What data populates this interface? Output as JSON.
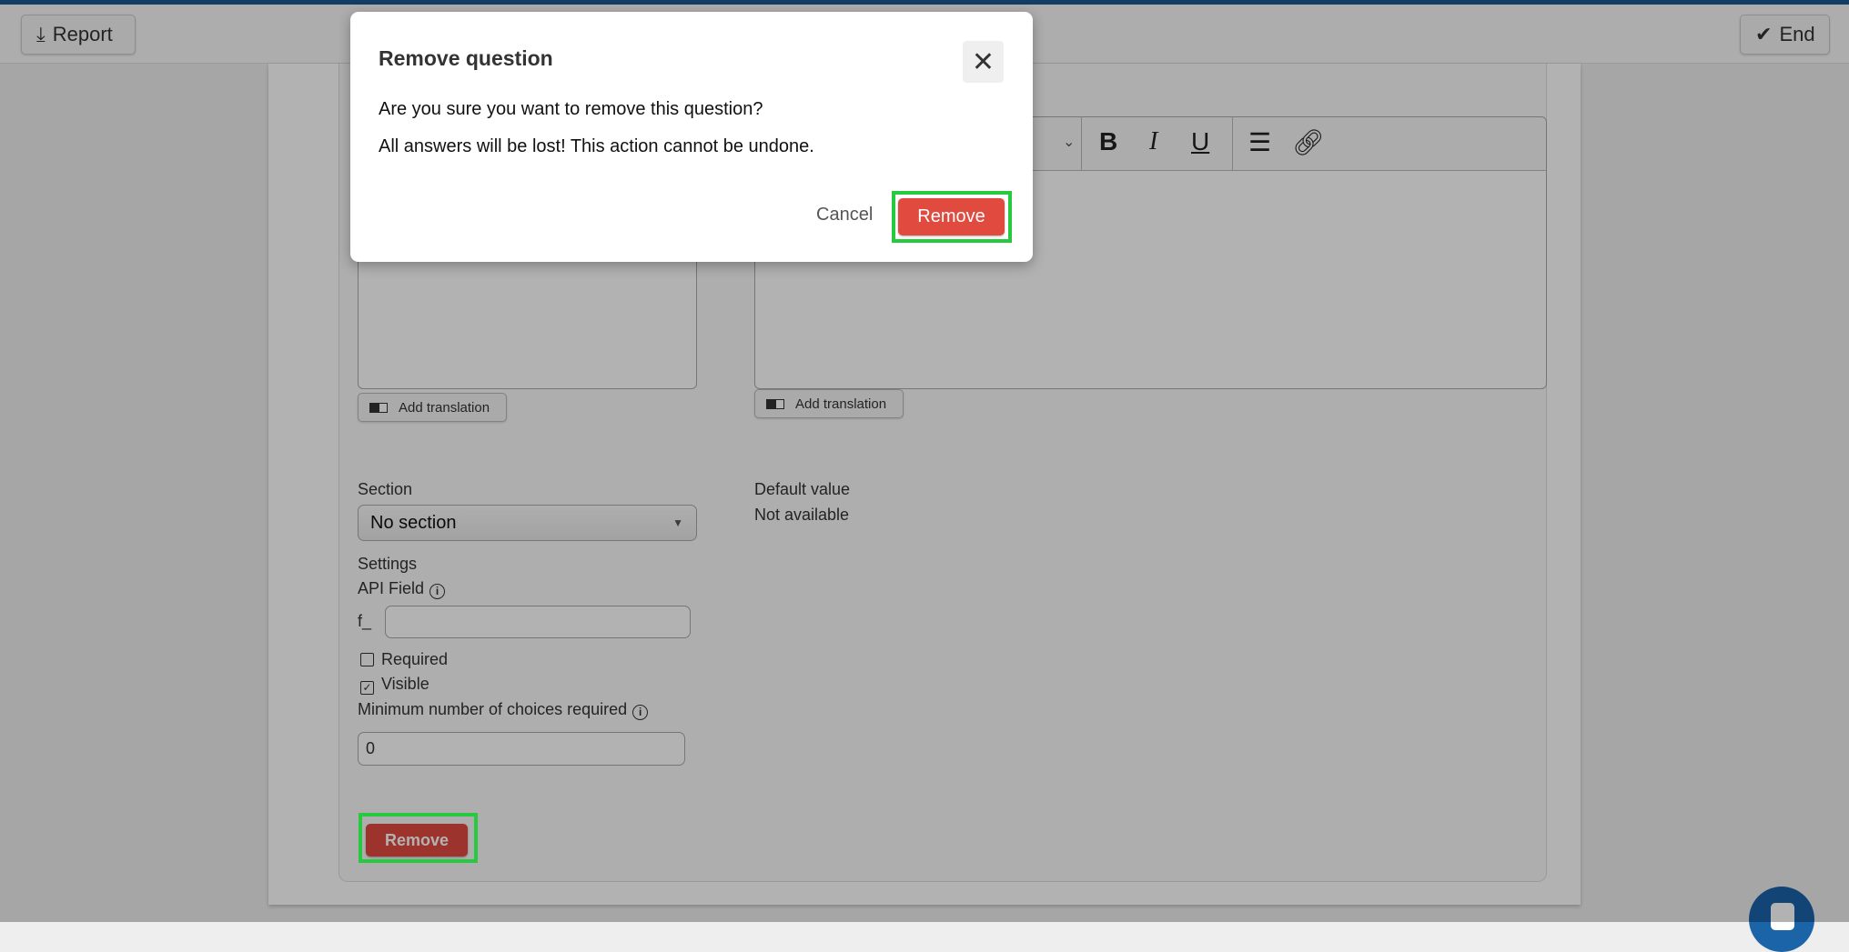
{
  "header": {
    "report_label": "Report",
    "end_label": "End"
  },
  "form": {
    "add_translation": "Add translation",
    "section_label": "Section",
    "section_value": "No section",
    "default_value_label": "Default value",
    "default_value": "Not available",
    "settings_label": "Settings",
    "api_field_label": "API Field",
    "api_prefix": "f_",
    "api_value": "",
    "required_label": "Required",
    "required_checked": false,
    "visible_label": "Visible",
    "visible_checked": true,
    "min_choices_label": "Minimum number of choices required",
    "min_choices_value": "0",
    "remove_label": "Remove"
  },
  "editor": {
    "toolbar": [
      "bold",
      "italic",
      "underline",
      "bullet-list",
      "link"
    ]
  },
  "modal": {
    "title": "Remove question",
    "line1": "Are you sure you want to remove this question?",
    "line2": "All answers will be lost! This action cannot be undone.",
    "cancel": "Cancel",
    "confirm": "Remove"
  },
  "colors": {
    "danger": "#e04a3f",
    "highlight": "#27c93f",
    "brand": "#1b5a8e"
  }
}
